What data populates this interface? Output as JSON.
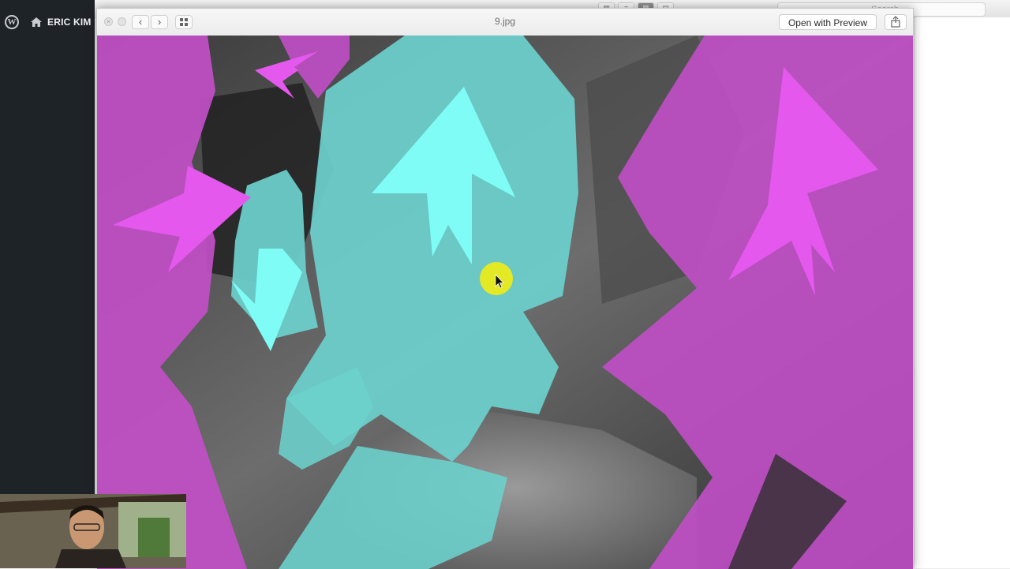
{
  "finder": {
    "search_placeholder": "Search"
  },
  "wp": {
    "site_name": "ERIC KIM",
    "logo_glyph": "W"
  },
  "quicklook": {
    "filename": "9.jpg",
    "open_button_label": "Open with Preview",
    "close_glyph": "×",
    "back_glyph": "‹",
    "forward_glyph": "›"
  },
  "colors": {
    "magenta_overlay": "#c14fc7",
    "magenta_arrow": "#e458ee",
    "cyan_overlay": "#6cd0cc",
    "cyan_arrow": "#7ffcf6",
    "cursor_highlight": "#f2ec13",
    "wp_sidebar": "#1e2328"
  }
}
